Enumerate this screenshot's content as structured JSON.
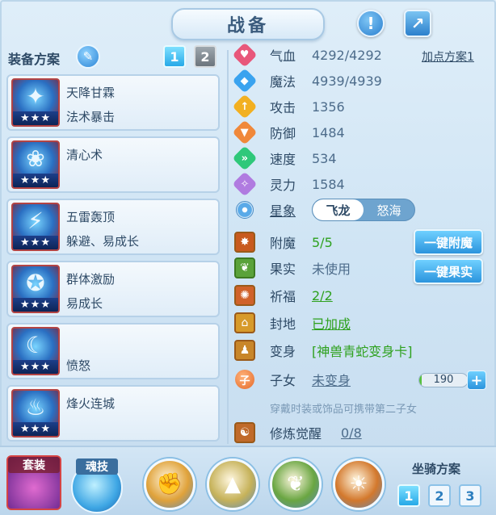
{
  "title": "战备",
  "header": {
    "info_icon": "exclamation-icon",
    "share_icon": "share-icon"
  },
  "left": {
    "section_title": "装备方案",
    "plan_tabs": [
      "1",
      "2"
    ],
    "active_plan": "1",
    "skills": [
      {
        "name": "天降甘霖",
        "effect": "法术暴击",
        "stars": "★★★",
        "glyph": "✦"
      },
      {
        "name": "清心术",
        "effect": "",
        "stars": "★★★",
        "glyph": "❀"
      },
      {
        "name": "五雷轰顶",
        "effect": "躲避、易成长",
        "stars": "★★★",
        "glyph": "⚡"
      },
      {
        "name": "群体激励",
        "effect": "易成长",
        "stars": "★★★",
        "glyph": "✪"
      },
      {
        "name": "",
        "effect": "愤怒",
        "stars": "★★★",
        "glyph": "☾"
      },
      {
        "name": "烽火连城",
        "effect": "",
        "stars": "★★★",
        "glyph": "♨"
      }
    ]
  },
  "stats": {
    "plan_link": "加点方案1",
    "rows": [
      {
        "label": "气血",
        "value": "4292/4292",
        "color": "#e8577a",
        "glyph": "♥"
      },
      {
        "label": "魔法",
        "value": "4939/4939",
        "color": "#3aa3ef",
        "glyph": "◆"
      },
      {
        "label": "攻击",
        "value": "1356",
        "color": "#f2b021",
        "glyph": "↑"
      },
      {
        "label": "防御",
        "value": "1484",
        "color": "#f0883a",
        "glyph": "▼"
      },
      {
        "label": "速度",
        "value": "534",
        "color": "#2fc87a",
        "glyph": "»"
      },
      {
        "label": "灵力",
        "value": "1584",
        "color": "#b07be0",
        "glyph": "✧"
      }
    ],
    "star_image": {
      "label": "星象",
      "options": [
        "飞龙",
        "怒海"
      ],
      "selected": "飞龙"
    }
  },
  "extras": {
    "enchant": {
      "label": "附魔",
      "value": "5/5",
      "button": "一键附魔"
    },
    "fruit": {
      "label": "果实",
      "value": "未使用",
      "button": "一键果实"
    },
    "blessing": {
      "label": "祈福",
      "value": "2/2"
    },
    "enfeoff": {
      "label": "封地",
      "value": "已加成"
    },
    "transform": {
      "label": "变身",
      "value": "[神兽青蛇变身卡]"
    },
    "children": {
      "label": "子女",
      "value": "未变身",
      "level": "190",
      "level_fraction": 0.05
    },
    "hint": "穿戴时装或饰品可携带第二子女",
    "cultivation": {
      "label": "修炼觉醒",
      "value": "0/8"
    }
  },
  "bottom": {
    "suit_label": "套装",
    "soul_label": "魂技",
    "mount_label": "坐骑方案",
    "mount_tabs": [
      "1",
      "2",
      "3"
    ],
    "active_mount": "1",
    "orbs": [
      {
        "name": "claw-orb",
        "glyph": "✊",
        "color": "#e0a23a"
      },
      {
        "name": "tower-orb",
        "glyph": "▲",
        "color": "#c6b25a"
      },
      {
        "name": "leaf-orb",
        "glyph": "❦",
        "color": "#6aa642"
      },
      {
        "name": "flame-orb",
        "glyph": "☀",
        "color": "#d3782c"
      }
    ]
  },
  "colors": {
    "accent": "#2b94dd",
    "highlight_green": "#2ea11e",
    "text": "#2e4a66"
  }
}
